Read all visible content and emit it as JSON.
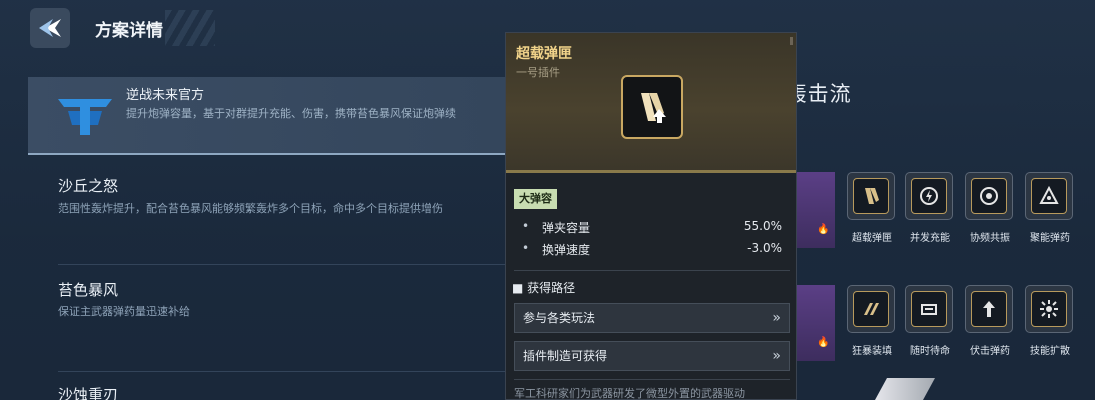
{
  "header": {
    "title": "方案详情"
  },
  "plans": [
    {
      "title": "逆战未来官方",
      "desc": "提升炮弹容量，基于对群提升充能、伤害，携带苔色暴风保证炮弹续"
    },
    {
      "title": "沙丘之怒",
      "desc": "范围性轰炸提升，配合苔色暴风能够频繁轰炸多个目标，命中多个目标提供增伤"
    },
    {
      "title": "苔色暴风",
      "desc": "保证主武器弹药量迅速补给"
    },
    {
      "title": "沙蚀重刃",
      "desc": ""
    }
  ],
  "plan_name": "之怒·范围轰击流",
  "plugin_rows": [
    {
      "slots": [
        {
          "label": "超载弹匣",
          "icon": "magazine-icon"
        },
        {
          "label": "并发充能",
          "icon": "charge-icon"
        },
        {
          "label": "协频共振",
          "icon": "resonance-icon"
        },
        {
          "label": "聚能弹药",
          "icon": "ammo-icon"
        }
      ]
    },
    {
      "slots": [
        {
          "label": "狂暴装填",
          "icon": "reload-icon"
        },
        {
          "label": "随时待命",
          "icon": "standby-icon"
        },
        {
          "label": "伏击弹药",
          "icon": "ambush-icon"
        },
        {
          "label": "技能扩散",
          "icon": "spread-icon"
        }
      ]
    }
  ],
  "popup": {
    "title": "超载弹匣",
    "subtitle": "一号插件",
    "badge": "大弹容",
    "stats": [
      {
        "label": "弹夹容量",
        "value": "55.0%"
      },
      {
        "label": "换弹速度",
        "value": "-3.0%"
      }
    ],
    "section_title": "获得路径",
    "paths": [
      {
        "label": "参与各类玩法"
      },
      {
        "label": "插件制造可获得"
      }
    ],
    "lore": "军工科研家们为武器研发了微型外置的武器驱动"
  },
  "colors": {
    "accent_gold": "#f1d38a",
    "badge_green": "#c8ddb1",
    "row_purple": "#5b3f86"
  }
}
